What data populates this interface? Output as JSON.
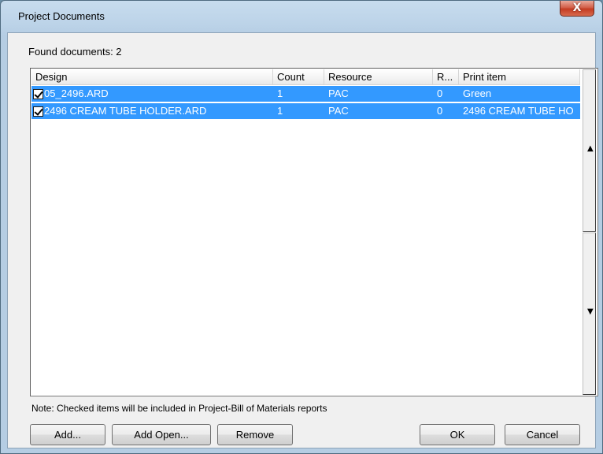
{
  "window": {
    "title": "Project Documents",
    "close_glyph": "X"
  },
  "found_label": "Found documents: 2",
  "table": {
    "columns": [
      "Design",
      "Count",
      "Resource",
      "R...",
      "Print item"
    ],
    "rows": [
      {
        "checked": true,
        "design": "05_2496.ARD",
        "count": "1",
        "resource": "PAC",
        "r": "0",
        "print_item": "Green"
      },
      {
        "checked": true,
        "design": "2496 CREAM TUBE HOLDER.ARD",
        "count": "1",
        "resource": "PAC",
        "r": "0",
        "print_item": "2496 CREAM TUBE HO"
      }
    ],
    "selection_color": "#3399ff"
  },
  "note": "Note: Checked items will be included in Project-Bill of Materials reports",
  "buttons": {
    "add": "Add...",
    "add_open": "Add Open...",
    "remove": "Remove",
    "ok": "OK",
    "cancel": "Cancel"
  },
  "icons": {
    "checkbox": "checkbox-checked-icon",
    "scroll_up": "arrow-up-icon",
    "scroll_down": "arrow-down-icon"
  }
}
